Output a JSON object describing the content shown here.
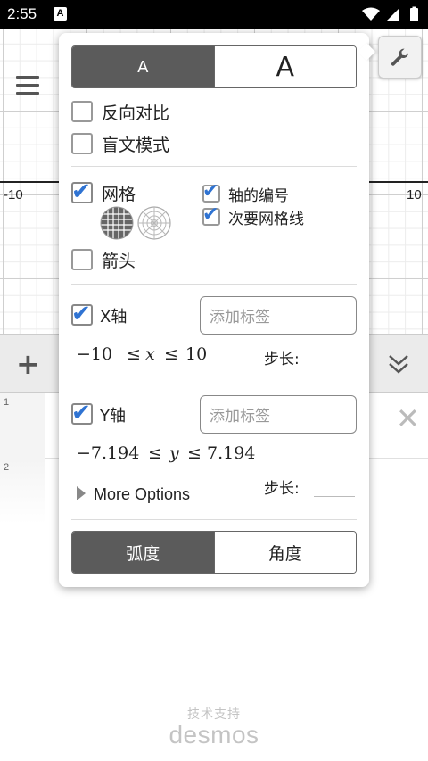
{
  "status_bar": {
    "time": "2:55",
    "app_badge": "A"
  },
  "graph": {
    "x_tick_left": "-10",
    "x_tick_right": "10"
  },
  "settings": {
    "text_size": {
      "small": "A",
      "large": "A",
      "selected": "small"
    },
    "reverse_contrast": {
      "label": "反向对比",
      "checked": false
    },
    "braille_mode": {
      "label": "盲文模式",
      "checked": false
    },
    "grid": {
      "label": "网格",
      "checked": true
    },
    "axis_numbers": {
      "label": "轴的编号",
      "checked": true
    },
    "minor_gridlines": {
      "label": "次要网格线",
      "checked": true
    },
    "arrows": {
      "label": "箭头",
      "checked": false
    },
    "x_axis": {
      "label": "X轴",
      "checked": true,
      "label_placeholder": "添加标签",
      "min": "−10",
      "relation": "≤",
      "var": "x",
      "max": "10",
      "step_label": "步长:"
    },
    "y_axis": {
      "label": "Y轴",
      "checked": true,
      "label_placeholder": "添加标签",
      "min": "−7.194",
      "relation": "≤",
      "var": "y",
      "max": "7.194",
      "step_label": "步长:"
    },
    "more_options": "More Options",
    "angle_mode": {
      "radians": "弧度",
      "degrees": "角度",
      "selected": "radians"
    }
  },
  "expressions": {
    "rows": [
      {
        "index": "1"
      },
      {
        "index": "2"
      }
    ]
  },
  "watermark": {
    "sub": "技术支持",
    "brand": "desmos"
  },
  "colors": {
    "check_blue": "#2f73d2",
    "segment_selected": "#5b5b5b"
  }
}
